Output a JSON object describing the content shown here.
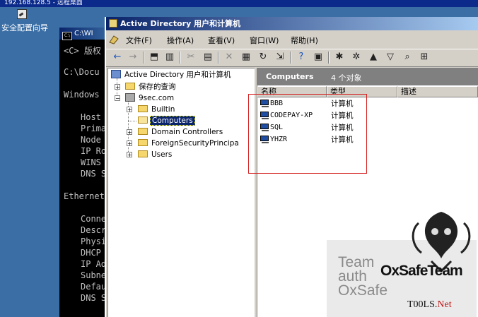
{
  "remote_session": {
    "title": "192.168.128.5 - 远程桌面"
  },
  "desktop": {
    "icon_label": "安全配置向导"
  },
  "console": {
    "title": "C:\\WI",
    "lines": [
      "<C> 版权",
      "C:\\Docu",
      "Windows",
      "Host",
      "Prima",
      "Node",
      "IP Ro",
      "WINS",
      "DNS S",
      "Ethernet",
      "Conne",
      "Descr",
      "Physi",
      "DHCP",
      "IP Ad",
      "Subne",
      "Defau",
      "DNS S"
    ]
  },
  "mmc": {
    "title": "Active Directory 用户和计算机",
    "menu": [
      "文件(F)",
      "操作(A)",
      "查看(V)",
      "窗口(W)",
      "帮助(H)"
    ],
    "tree": {
      "root": "Active Directory 用户和计算机",
      "saved_queries": "保存的查询",
      "domain": "9sec.com",
      "children": [
        "Builtin",
        "Computers",
        "Domain Controllers",
        "ForeignSecurityPrincipa",
        "Users"
      ]
    },
    "right": {
      "container": "Computers",
      "count": "4 个对象",
      "columns": [
        "名称",
        "类型",
        "描述"
      ],
      "rows": [
        {
          "name": "BBB",
          "type": "计算机"
        },
        {
          "name": "CODEPAY-XP",
          "type": "计算机"
        },
        {
          "name": "SQL",
          "type": "计算机"
        },
        {
          "name": "YHZR",
          "type": "计算机"
        }
      ]
    }
  },
  "watermark": {
    "line1": "Team",
    "line2": "auth",
    "line3": "OxSafe",
    "brand": "OxSafeTeam",
    "site": "T00LS.",
    "site_suffix": "Net"
  }
}
